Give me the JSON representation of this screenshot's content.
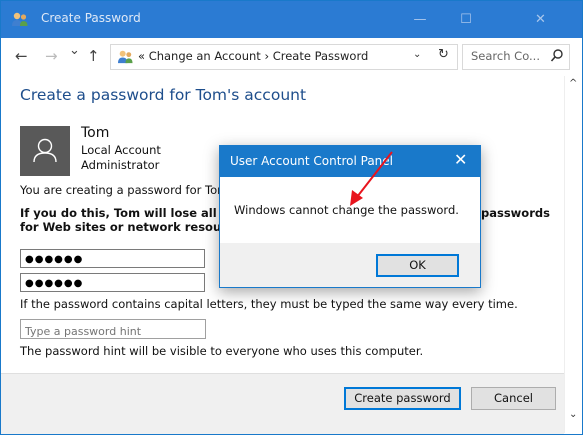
{
  "window": {
    "title": "Create Password",
    "minimize": "—",
    "maximize": "☐",
    "close": "✕"
  },
  "nav": {
    "back": "←",
    "forward": "→",
    "recent": "⌄",
    "up": "↑"
  },
  "address": {
    "crumbs": "«  Change an Account  ›  Create Password",
    "dropdown": "⌄",
    "refresh": "↻"
  },
  "search": {
    "placeholder": "Search Co..."
  },
  "page": {
    "heading": "Create a password for Tom's account",
    "user_name": "Tom",
    "user_type": "Local Account",
    "user_role": "Administrator",
    "intro": "You are creating a password for Tom.",
    "warning_line1_left": "If you do this, Tom will lose all EFS-e",
    "warning_line1_right": "passwords",
    "warning_line2": "for Web sites or network resources.",
    "password_mask": "●●●●●●",
    "confirm_mask": "●●●●●●",
    "caps_note": "If the password contains capital letters, they must be typed the same way every time.",
    "hint_placeholder": "Type a password hint",
    "hint_note": "The password hint will be visible to everyone who uses this computer."
  },
  "buttons": {
    "create": "Create password",
    "cancel": "Cancel"
  },
  "dialog": {
    "title": "User Account Control Panel",
    "close": "✕",
    "message": "Windows cannot change the password.",
    "ok": "OK"
  },
  "scrollbar": {
    "up": "^",
    "down": "⌄"
  },
  "colors": {
    "titlebar": "#2b7bd3",
    "dialog_titlebar": "#1979ca",
    "heading": "#1e4e8c",
    "arrow": "#e8141d"
  }
}
